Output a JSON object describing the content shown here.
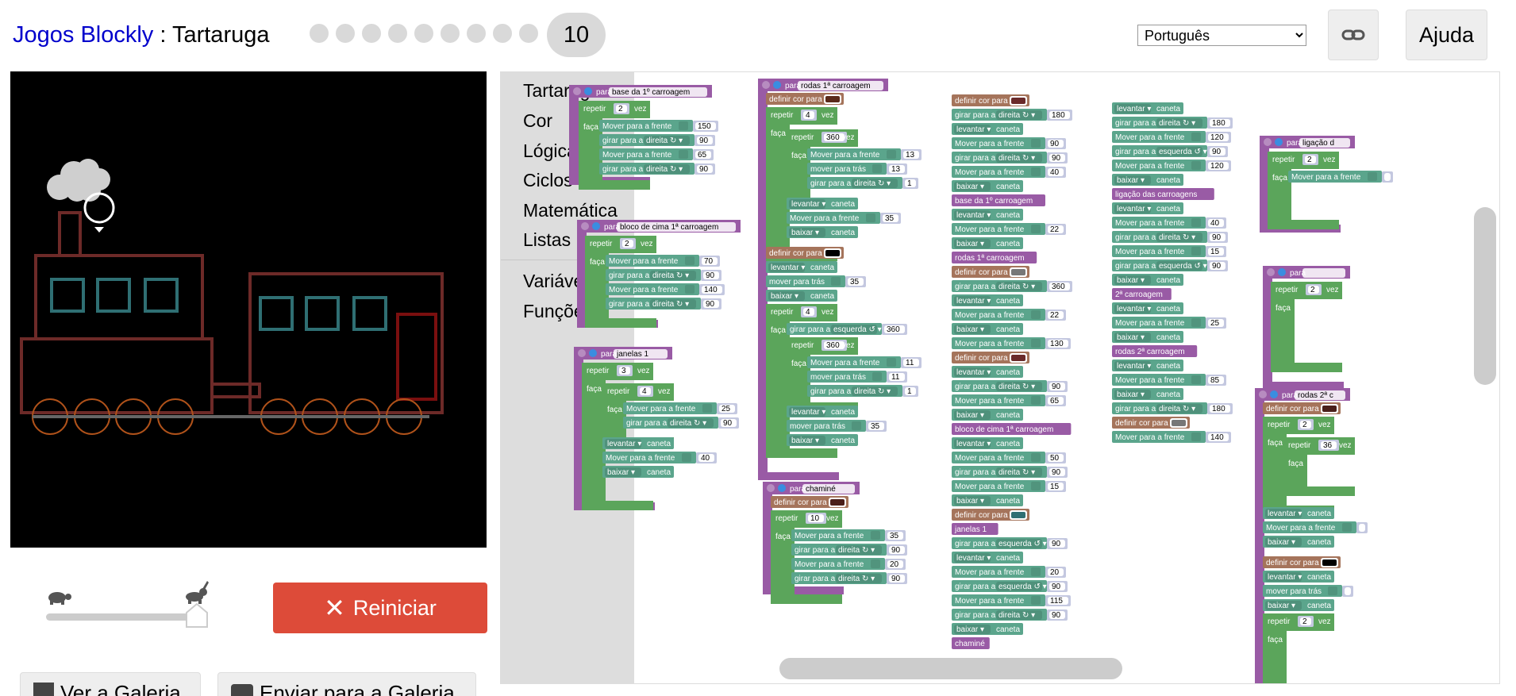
{
  "header": {
    "app_link": "Jogos Blockly",
    "separator": " : ",
    "page": "Tartaruga",
    "level": "10",
    "language": "Português",
    "help": "Ajuda"
  },
  "controls": {
    "reset": "Reiniciar",
    "gallery_view": "Ver a Galeria",
    "gallery_submit": "Enviar para a Galeria",
    "speed_level": 1.0
  },
  "toolbox": {
    "categories": [
      "Tartaruga",
      "Cor",
      "Lógica",
      "Ciclos",
      "Matemática",
      "Listas",
      "Variáveis",
      "Funções"
    ]
  },
  "blocks": {
    "def_base": "para base da 1º carroagem",
    "def_bloco": "para bloco de cima 1ª carroagem",
    "def_janelas": "para janelas 1",
    "def_rodas": "para rodas 1ª carroagem",
    "def_chamine": "para chaminé",
    "def_ligacao": "para ligação d",
    "def_rodas2": "para rodas 2ª c",
    "repetir": "repetir",
    "vez": "vez",
    "faca": "faça",
    "mover_frente": "Mover para a frente",
    "mover_tras": "mover para trás",
    "girar": "girar para a",
    "direita": "direita ↻",
    "esquerda": "esquerda ↺",
    "levantar": "levantar",
    "baixar": "baixar",
    "caneta": "caneta",
    "definir_cor": "definir cor para",
    "call_base": "base da 1º carroagem",
    "call_rodas": "rodas 1ª carroagem",
    "call_bloco": "bloco de cima 1ª carroagem",
    "call_janelas": "janelas 1",
    "call_chamine": "chaminé",
    "call_ligacao": "ligação das carroagens",
    "call_2a": "2ª carroagem",
    "call_rodas2": "rodas 2ª carroagem"
  }
}
